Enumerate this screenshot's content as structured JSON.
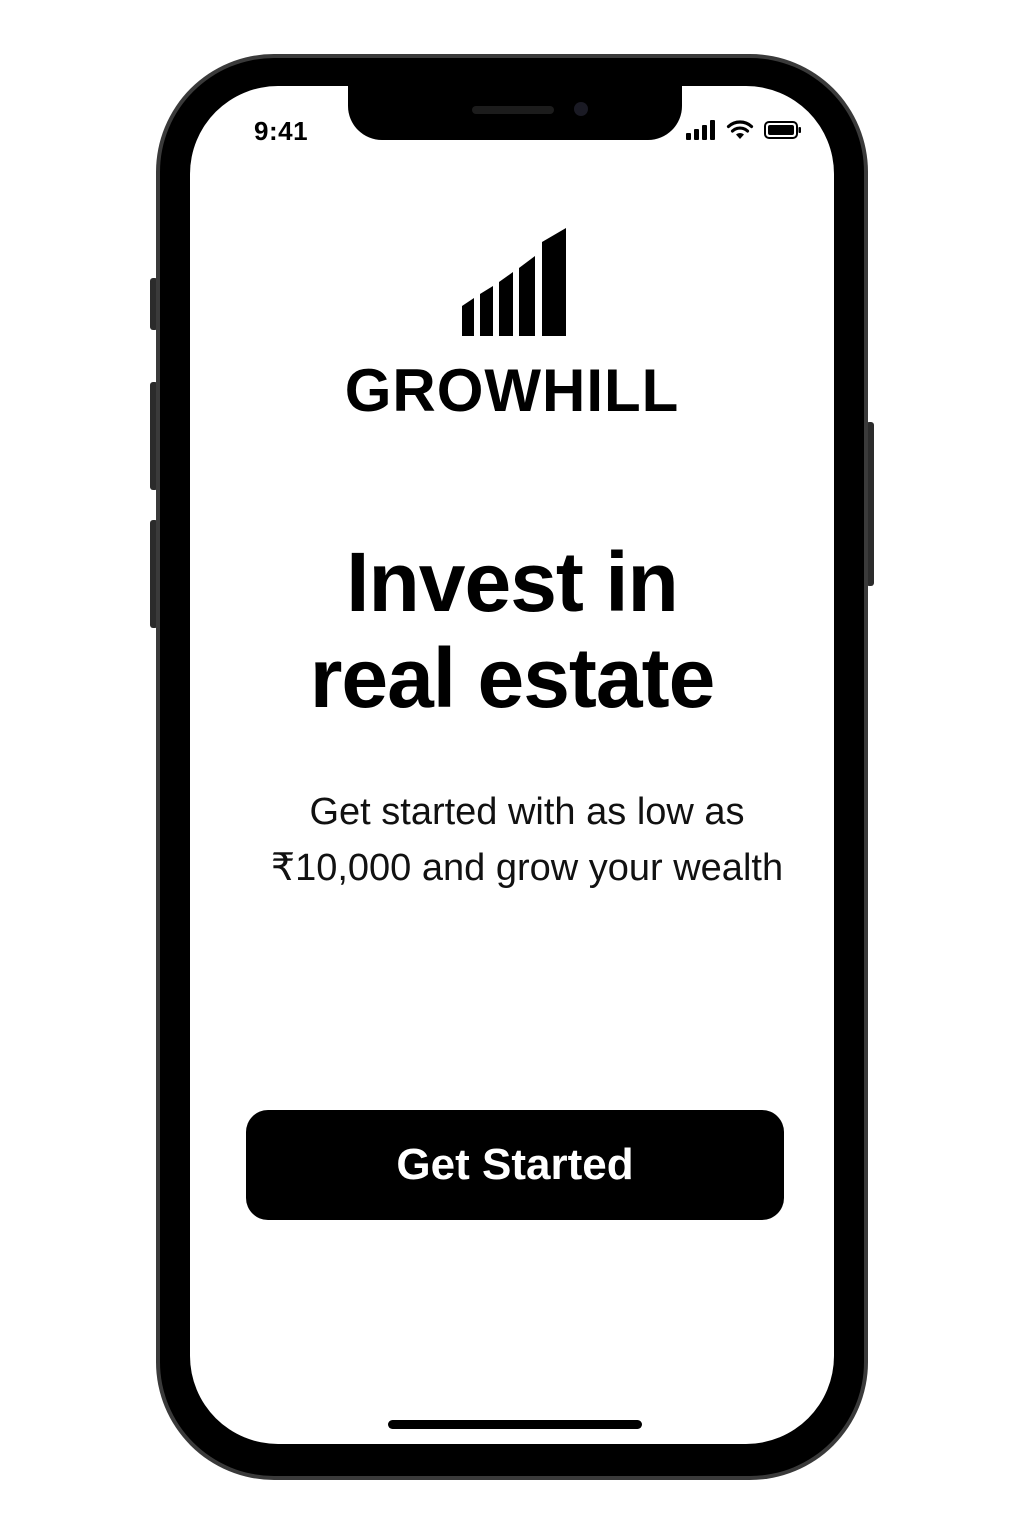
{
  "status_bar": {
    "time": "9:41",
    "icons": [
      "cellular-signal-icon",
      "wifi-icon",
      "battery-icon"
    ]
  },
  "brand": {
    "logo_icon": "rising-bars-logo",
    "name": "GROWHILL"
  },
  "hero": {
    "headline_line1": "Invest in",
    "headline_line2": "real estate",
    "subtitle_line1": "Get started with as low as",
    "subtitle_line2": "₹10,000 and grow your wealth"
  },
  "cta": {
    "label": "Get Started"
  },
  "colors": {
    "background": "#ffffff",
    "primary": "#000000",
    "button_text": "#ffffff"
  }
}
